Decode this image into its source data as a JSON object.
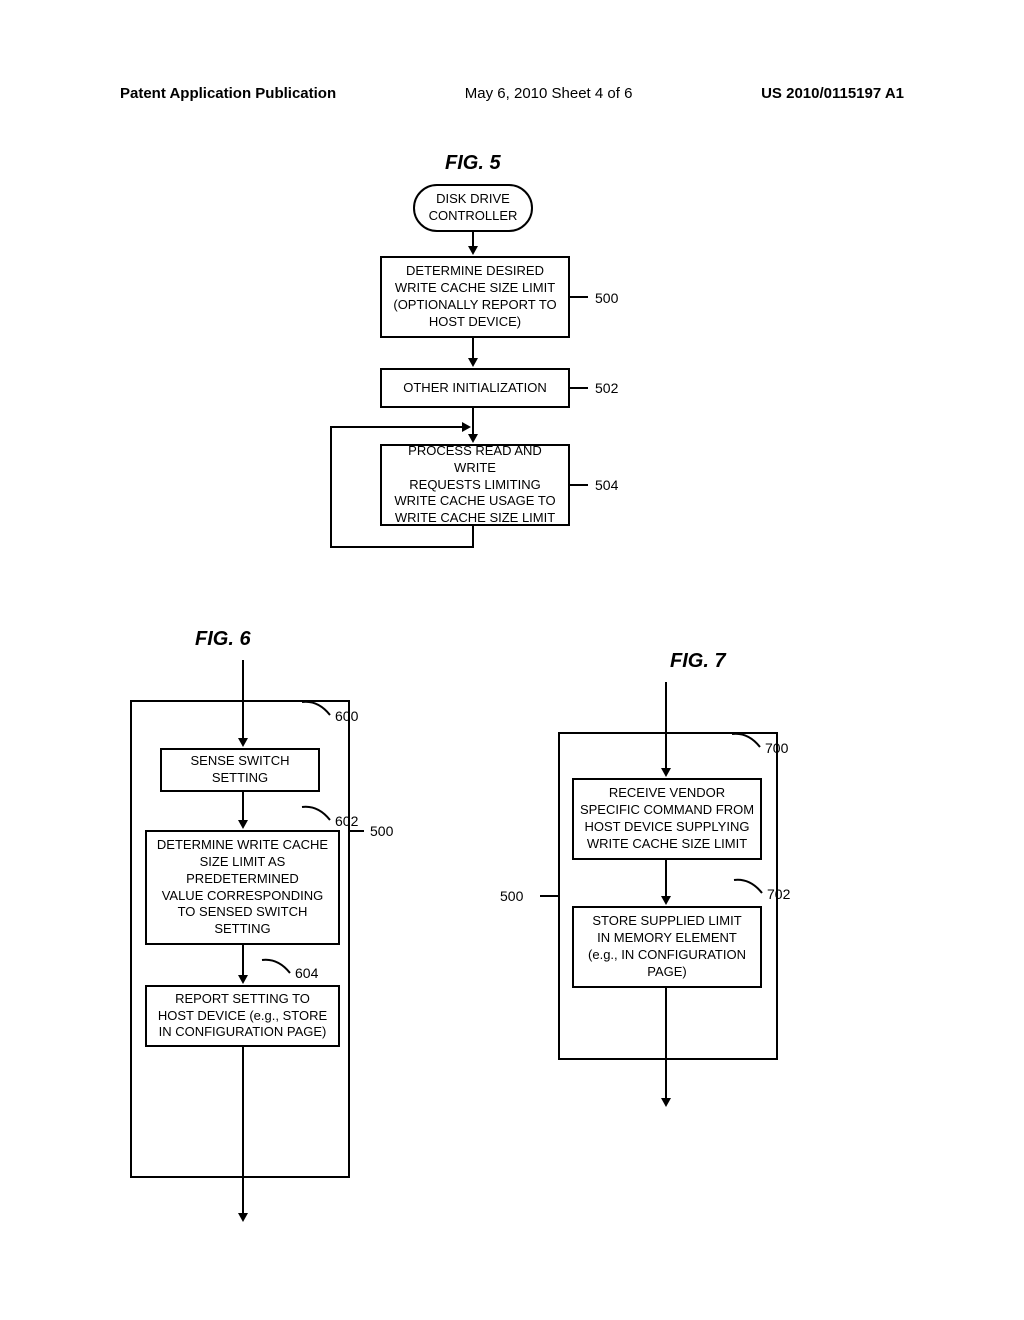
{
  "header": {
    "left": "Patent Application Publication",
    "center": "May 6, 2010  Sheet 4 of 6",
    "right": "US 2010/0115197 A1"
  },
  "fig5": {
    "title": "FIG. 5",
    "start": "DISK DRIVE\nCONTROLLER",
    "box500": "DETERMINE DESIRED\nWRITE CACHE SIZE LIMIT\n(OPTIONALLY REPORT TO\nHOST DEVICE)",
    "box502": "OTHER INITIALIZATION",
    "box504": "PROCESS READ AND WRITE\nREQUESTS LIMITING\nWRITE CACHE USAGE TO\nWRITE CACHE SIZE LIMIT",
    "ref500": "500",
    "ref502": "502",
    "ref504": "504"
  },
  "fig6": {
    "title": "FIG. 6",
    "box600": "SENSE SWITCH\nSETTING",
    "box602": "DETERMINE WRITE CACHE\nSIZE LIMIT AS\nPREDETERMINED\nVALUE CORRESPONDING\nTO SENSED SWITCH\nSETTING",
    "box604": "REPORT SETTING TO\nHOST DEVICE (e.g., STORE\nIN CONFIGURATION PAGE)",
    "ref600": "600",
    "ref602": "602",
    "ref604": "604",
    "ref500": "500"
  },
  "fig7": {
    "title": "FIG. 7",
    "box700": "RECEIVE VENDOR\nSPECIFIC COMMAND FROM\nHOST DEVICE SUPPLYING\nWRITE CACHE SIZE LIMIT",
    "box702": "STORE SUPPLIED LIMIT\nIN MEMORY ELEMENT\n(e.g., IN CONFIGURATION\nPAGE)",
    "ref700": "700",
    "ref702": "702",
    "ref500": "500"
  }
}
